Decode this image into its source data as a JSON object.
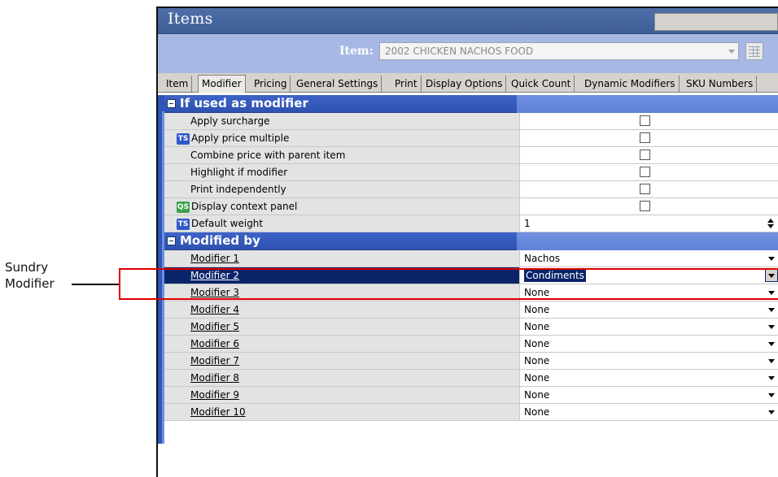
{
  "callout": {
    "line1": "Sundry",
    "line2": "Modifier"
  },
  "window": {
    "title": "Items"
  },
  "item": {
    "label": "Item:",
    "value": "2002 CHICKEN NACHOS FOOD"
  },
  "tabs": [
    "Item",
    "Modifier",
    "Pricing",
    "General Settings",
    "Print",
    "Display Options",
    "Quick Count",
    "Dynamic Modifiers",
    "SKU Numbers"
  ],
  "active_tab": "Modifier",
  "section1": {
    "title": "If used as modifier",
    "rows": [
      {
        "label": "Apply surcharge"
      },
      {
        "label": "Apply price multiple",
        "icon": "TS"
      },
      {
        "label": "Combine price with parent item"
      },
      {
        "label": "Highlight if modifier"
      },
      {
        "label": "Print independently"
      },
      {
        "label": "Display context panel",
        "icon": "QS"
      },
      {
        "label": "Default weight",
        "icon": "TS",
        "value": "1"
      }
    ]
  },
  "section2": {
    "title": "Modified by",
    "rows": [
      {
        "label": "Modifier 1",
        "value": "Nachos"
      },
      {
        "label": "Modifier 2",
        "value": "Condiments",
        "selected": true
      },
      {
        "label": "Modifier 3",
        "value": "None"
      },
      {
        "label": "Modifier 4",
        "value": "None"
      },
      {
        "label": "Modifier 5",
        "value": "None"
      },
      {
        "label": "Modifier 6",
        "value": "None"
      },
      {
        "label": "Modifier 7",
        "value": "None"
      },
      {
        "label": "Modifier 8",
        "value": "None"
      },
      {
        "label": "Modifier 9",
        "value": "None"
      },
      {
        "label": "Modifier 10",
        "value": "None"
      }
    ]
  },
  "colors": {
    "title_blue": "#3f5e98",
    "section_blue": "#2e52b0",
    "selection": "#0a246a",
    "callout_red": "#e00000"
  }
}
